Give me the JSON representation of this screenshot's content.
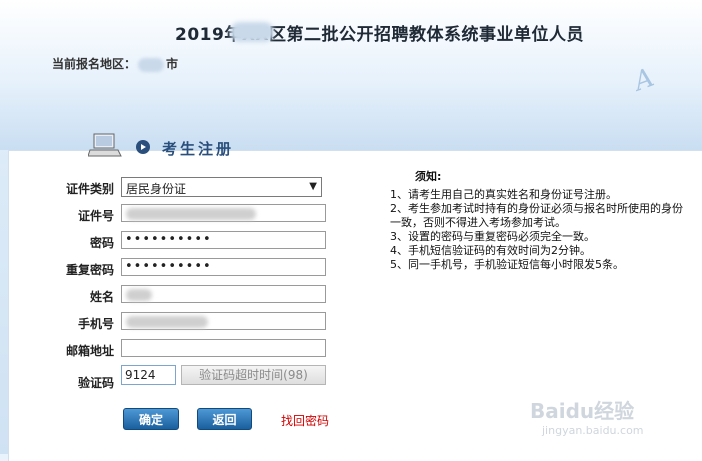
{
  "header": {
    "title": "2019年XX区第二批公开招聘教体系统事业单位人员",
    "region_label": "当前报名地区：",
    "region_suffix": "市"
  },
  "section": {
    "title": "考生注册"
  },
  "form": {
    "id_type": {
      "label": "证件类别",
      "value": "居民身份证"
    },
    "id_number": {
      "label": "证件号"
    },
    "password": {
      "label": "密码",
      "value": "••••••••••"
    },
    "password_confirm": {
      "label": "重复密码",
      "value": "••••••••••"
    },
    "name": {
      "label": "姓名"
    },
    "phone": {
      "label": "手机号"
    },
    "email": {
      "label": "邮箱地址",
      "value": ""
    },
    "captcha": {
      "label": "验证码",
      "value": "9124",
      "button": "验证码超时时间(98)"
    },
    "confirm_button": "确定",
    "back_button": "返回",
    "recover_link": "找回密码"
  },
  "notice": {
    "title": "须知:",
    "items": [
      "1、请考生用自己的真实姓名和身份证号注册。",
      "2、考生参加考试时持有的身份证必须与报名时所使用的身份",
      "一致，否则不得进入考场参加考试。",
      "3、设置的密码与重复密码必须完全一致。",
      "4、手机短信验证码的有效时间为2分钟。",
      "5、同一手机号，手机验证短信每小时限发5条。"
    ]
  },
  "watermark": {
    "brand": "Baidu经验",
    "url": "jingyan.baidu.com"
  }
}
